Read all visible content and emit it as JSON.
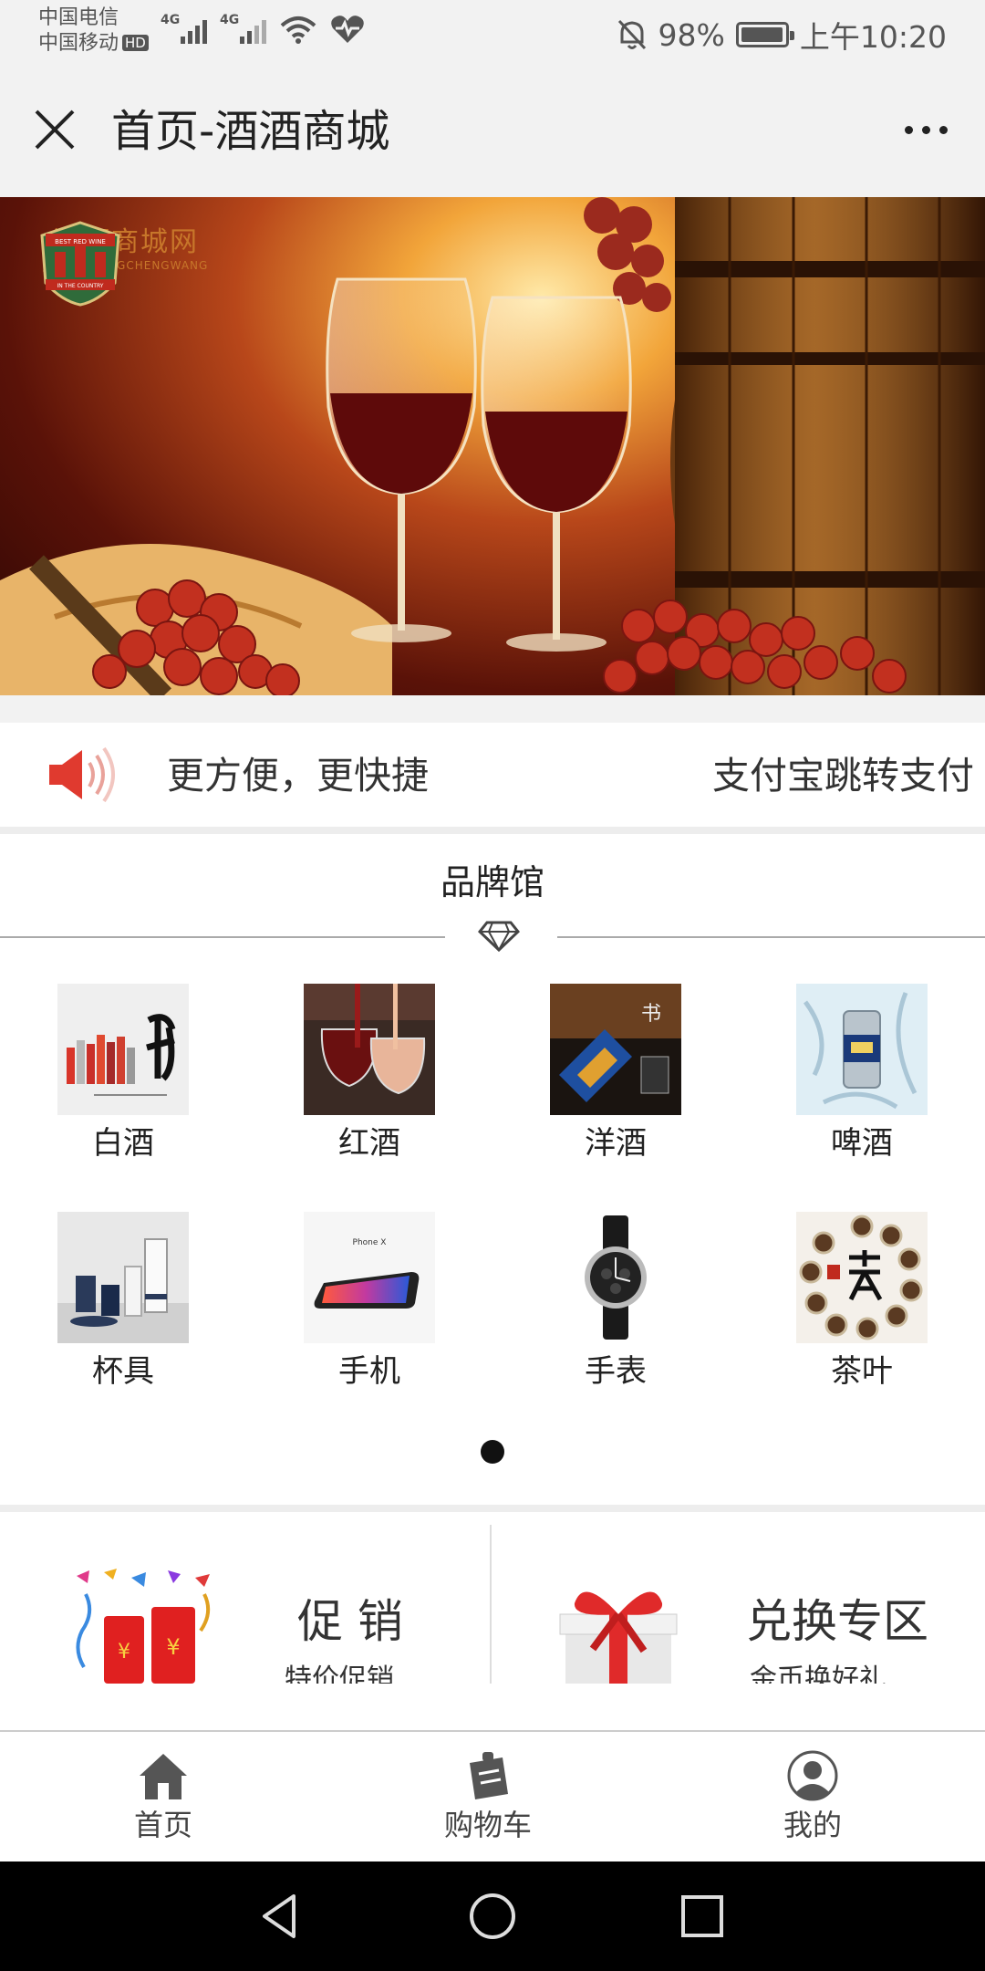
{
  "status_bar": {
    "carrier_1": "中国电信",
    "carrier_2": "中国移动",
    "hd_badge": "HD",
    "network_1": "4G",
    "network_2": "4G",
    "battery_percent": "98%",
    "battery_level": 0.98,
    "time": "上午10:20"
  },
  "title_bar": {
    "title": "首页-酒酒商城"
  },
  "banner": {
    "logo_badge_line_1": "BEST RED WINE",
    "logo_badge_line_2": "IN THE COUNTRY",
    "logo_name": "酒酒商城网",
    "logo_subtitle": "JIUJIU SHANGCHENGWANG"
  },
  "notice": {
    "text": "更方便，更快捷",
    "scroll_text": "支付宝跳转支付"
  },
  "brand_hall": {
    "title": "品牌馆",
    "items": [
      {
        "label": "白酒",
        "icon": "baijiu-image"
      },
      {
        "label": "红酒",
        "icon": "red-wine-image"
      },
      {
        "label": "洋酒",
        "icon": "foreign-liquor-image"
      },
      {
        "label": "啤酒",
        "icon": "beer-image"
      },
      {
        "label": "杯具",
        "icon": "cups-image"
      },
      {
        "label": "手机",
        "icon": "phone-image"
      },
      {
        "label": "手表",
        "icon": "watch-image"
      },
      {
        "label": "茶叶",
        "icon": "tea-image"
      }
    ],
    "pager_current": 1
  },
  "promos": [
    {
      "title": "促 销",
      "subtitle": "特价促销"
    },
    {
      "title": "兑换专区",
      "subtitle": "金币换好礼"
    }
  ],
  "tabbar": {
    "items": [
      {
        "label": "首页",
        "icon": "home-icon"
      },
      {
        "label": "购物车",
        "icon": "cart-icon"
      },
      {
        "label": "我的",
        "icon": "profile-icon"
      }
    ]
  },
  "colors": {
    "accent_red": "#e03a2f",
    "logo_green": "#2f6b3a",
    "logo_gold": "#c7762a"
  }
}
